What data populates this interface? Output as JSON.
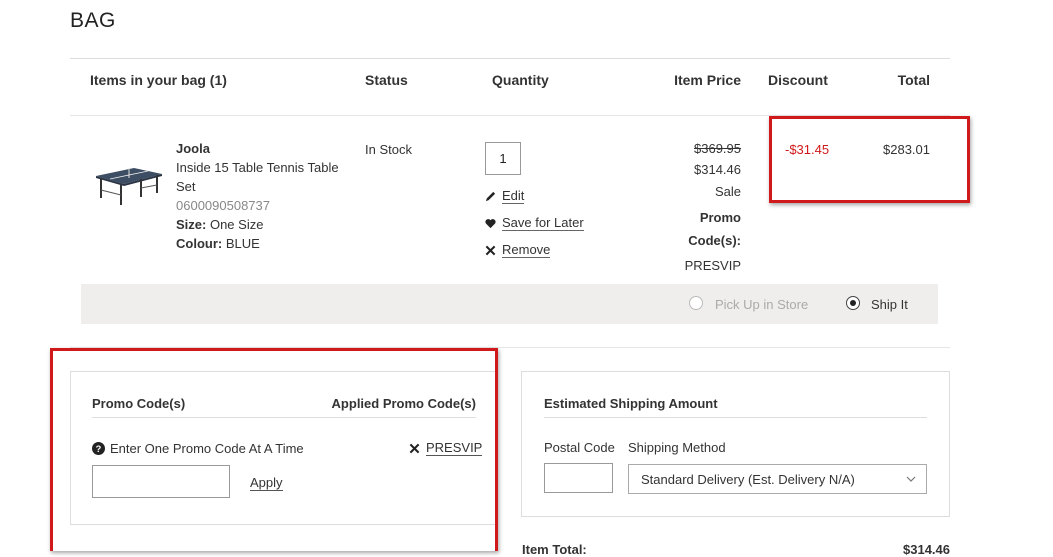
{
  "page": {
    "title": "BAG"
  },
  "table": {
    "headers": {
      "items": "Items in your bag (1)",
      "status": "Status",
      "quantity": "Quantity",
      "item_price": "Item Price",
      "discount": "Discount",
      "total": "Total"
    }
  },
  "item": {
    "brand": "Joola",
    "name_line1": "Inside 15 Table Tennis Table",
    "name_line2": "Set",
    "sku": "0600090508737",
    "size_label": "Size:",
    "size_value": "One Size",
    "colour_label": "Colour:",
    "colour_value": "BLUE",
    "status": "In Stock",
    "quantity": "1",
    "actions": {
      "edit": "Edit",
      "save": "Save for Later",
      "remove": "Remove"
    },
    "original_price": "$369.95",
    "sale_price": "$314.46",
    "sale_label": "Sale",
    "promo_label_1": "Promo",
    "promo_label_2": "Code(s):",
    "promo_code": "PRESVIP",
    "discount": "-$31.45",
    "total": "$283.01"
  },
  "fulfillment": {
    "pickup": "Pick Up in Store",
    "ship": "Ship It",
    "selected": "ship"
  },
  "promo_panel": {
    "title": "Promo Code(s)",
    "applied_title": "Applied Promo Code(s)",
    "hint": "Enter One Promo Code At A Time",
    "applied_code": "PRESVIP",
    "apply": "Apply",
    "input_value": ""
  },
  "shipping_panel": {
    "title": "Estimated Shipping Amount",
    "postal_label": "Postal Code",
    "method_label": "Shipping Method",
    "method_value": "Standard Delivery (Est. Delivery N/A)",
    "postal_value": ""
  },
  "summary": {
    "item_total_label": "Item Total:",
    "item_total_value": "$314.46"
  },
  "colors": {
    "accent_red": "#d0191a",
    "discount_red": "#d0191a"
  }
}
